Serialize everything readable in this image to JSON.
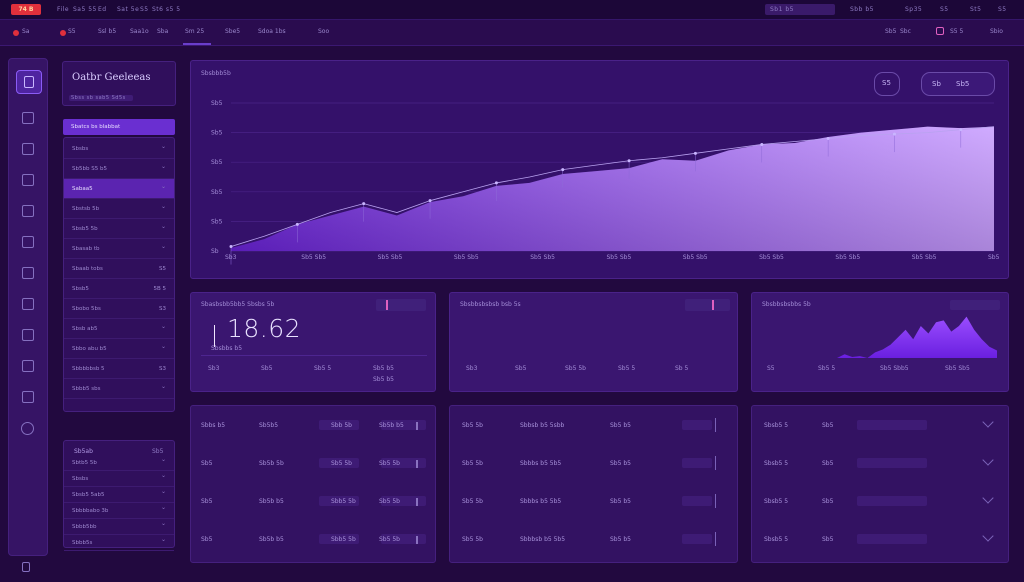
{
  "topbar": {
    "brand": "74 B",
    "menu": [
      "File",
      "Sa5 55",
      "Ed",
      "Sat 5e",
      "S5",
      "St6 s5 5"
    ],
    "right_items": [
      "Sb1 b5",
      "Sbb b5",
      "Sp35",
      "S5",
      "St5",
      "S5"
    ]
  },
  "subbar": {
    "items": [
      "Sa",
      "S5",
      "Ssl b5",
      "Saa1o",
      "Sba",
      "Sm 25",
      "Sbe5",
      "Sdoa 1bs",
      "Soo"
    ],
    "right_items": [
      "Sb5",
      "Sbc",
      "S5 5",
      "Sbio"
    ]
  },
  "leftnav": {
    "title": "Oatbr Geeleeas",
    "subtitle": "Sbss sb sab5 Sd5s",
    "header_item": "Sbatcs bs blabbat",
    "items": [
      {
        "label": "Sbsbs",
        "value": ""
      },
      {
        "label": "Sb5bb S5 b5",
        "value": ""
      },
      {
        "label": "Sabaa5",
        "value": "",
        "active": true
      },
      {
        "label": "Sbstsb 5b",
        "value": ""
      },
      {
        "label": "Sbsb5 5b",
        "value": ""
      },
      {
        "label": "Sbasab tb",
        "value": ""
      },
      {
        "label": "Sbaab tobs",
        "value": "S5"
      },
      {
        "label": "Sbsb5",
        "value": "5B 5"
      },
      {
        "label": "Sbobo 5bs",
        "value": "S3"
      },
      {
        "label": "Sbsb ab5",
        "value": ""
      },
      {
        "label": "Sbbo abu b5",
        "value": ""
      },
      {
        "label": "Sbbbbbsb 5",
        "value": "S3"
      },
      {
        "label": "Sbbb5 sbs",
        "value": ""
      }
    ],
    "lower_panel": {
      "title": "Sb5ab",
      "value": "Sb5",
      "items": [
        "Sbtb5 5b",
        "Sbsbs",
        "Sbsb5 5ab5",
        "Sbbbbabo 3b",
        "Sbbb5bb",
        "Sbbb5s"
      ]
    }
  },
  "main_chart": {
    "label": "Sbsbbb5b",
    "buttons": [
      "S5",
      "Sb",
      "Sb5"
    ],
    "chart_data": {
      "type": "area",
      "x": [
        "Sb3",
        "Sb5 Sb5",
        "Sb5 Sb5",
        "Sb5 Sb5",
        "Sb5 Sb5",
        "Sb5 Sb5",
        "Sb5 Sb5",
        "Sb5 Sb5",
        "Sb5 Sb5",
        "Sb5 Sb5",
        "Sb5"
      ],
      "y_ticks": [
        "Sb5",
        "Sb5",
        "Sb5",
        "Sb5",
        "Sb5",
        "Sb"
      ],
      "series": [
        {
          "fill_values": [
            2,
            8,
            18,
            24,
            30,
            24,
            33,
            37,
            44,
            46,
            52,
            54,
            56,
            62,
            61,
            68,
            72,
            73,
            77,
            80,
            82,
            84,
            83,
            84
          ],
          "line_values": [
            3,
            10,
            18,
            26,
            32,
            26,
            34,
            40,
            46,
            50,
            55,
            58,
            61,
            63,
            66,
            69,
            72,
            74,
            76,
            78,
            79,
            80,
            82,
            84
          ]
        }
      ],
      "ylim": [
        0,
        100
      ],
      "grid": true
    }
  },
  "stat_cards": [
    {
      "label": "Sbasbsbb5bb5 Sbsbs 5b",
      "value": "18.62",
      "sublabel": "Sbsbbs b5",
      "footer": [
        "Sb3",
        "Sb5",
        "Sb5 5",
        "Sb5 b5"
      ]
    },
    {
      "label": "Sbsbbsbsbsb bsb 5s",
      "value": "",
      "footer": [
        "Sb3",
        "Sb5",
        "Sb5 5b",
        "Sb5 5",
        "Sb 5"
      ]
    },
    {
      "label": "Sbsbbsbsbbs 5b",
      "value": "",
      "footer": [
        "S5",
        "Sb5 5",
        "Sb5 Sbb5",
        "Sb5 Sb5"
      ],
      "chart_data": {
        "type": "area",
        "values": [
          0,
          4,
          1,
          2,
          0,
          6,
          9,
          14,
          22,
          30,
          20,
          34,
          26,
          38,
          40,
          28,
          34,
          44,
          30,
          20,
          12,
          8
        ],
        "ylim": [
          0,
          50
        ]
      }
    }
  ],
  "tables": [
    {
      "rows": [
        [
          "Sbbs b5",
          "Sb5b5",
          "Sbb 5b",
          "Sb5b b5"
        ],
        [
          "Sb5",
          "Sb5b 5b",
          "Sb5 5b",
          "Sb5 5b"
        ],
        [
          "Sb5",
          "Sb5b b5",
          "Sbb5 5b",
          "Sb5 5b"
        ],
        [
          "Sb5",
          "Sb5b b5",
          "Sbb5 5b",
          "Sb5 5b"
        ]
      ]
    },
    {
      "rows": [
        [
          "Sb5 5b",
          "Sbbsb b5 5sbb",
          "Sb5 b5"
        ],
        [
          "Sb5 5b",
          "Sbbbs b5 5b5",
          "Sb5 b5"
        ],
        [
          "Sb5 5b",
          "Sbbbs b5 5b5",
          "Sb5 b5"
        ],
        [
          "Sb5 5b",
          "Sbbbsb b5 5b5",
          "Sb5 b5"
        ]
      ]
    },
    {
      "rows": [
        [
          "Sbsb5 5",
          "Sb5"
        ],
        [
          "Sbsb5 5",
          "Sb5"
        ],
        [
          "Sbsb5 5",
          "Sb5"
        ],
        [
          "Sbsb5 5",
          "Sb5"
        ]
      ]
    }
  ]
}
